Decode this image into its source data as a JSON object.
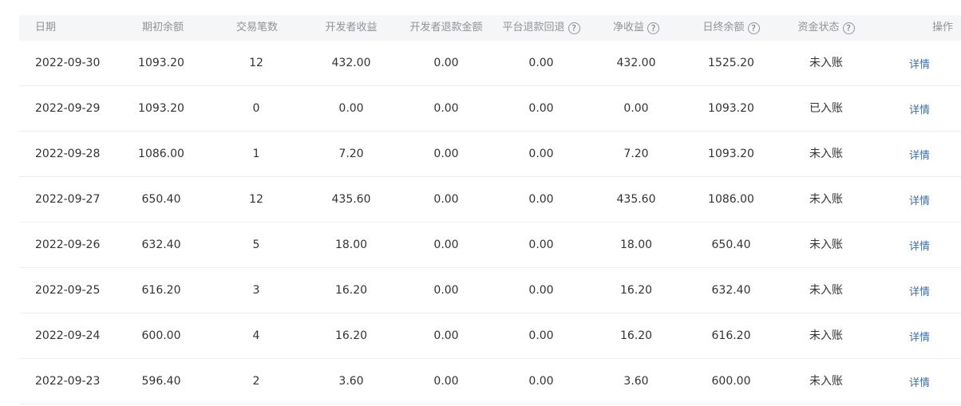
{
  "table": {
    "headers": {
      "date": "日期",
      "opening_balance": "期初余额",
      "transaction_count": "交易笔数",
      "dev_revenue": "开发者收益",
      "dev_refund": "开发者退款金额",
      "platform_refund": "平台退款回退",
      "net_revenue": "净收益",
      "closing_balance": "日终余额",
      "fund_status": "资金状态",
      "actions": "操作"
    },
    "help_glyph": "?",
    "rows": [
      {
        "date": "2022-09-30",
        "opening_balance": "1093.20",
        "transaction_count": "12",
        "dev_revenue": "432.00",
        "dev_refund": "0.00",
        "platform_refund": "0.00",
        "net_revenue": "432.00",
        "closing_balance": "1525.20",
        "fund_status": "未入账",
        "action": "详情"
      },
      {
        "date": "2022-09-29",
        "opening_balance": "1093.20",
        "transaction_count": "0",
        "dev_revenue": "0.00",
        "dev_refund": "0.00",
        "platform_refund": "0.00",
        "net_revenue": "0.00",
        "closing_balance": "1093.20",
        "fund_status": "已入账",
        "action": "详情"
      },
      {
        "date": "2022-09-28",
        "opening_balance": "1086.00",
        "transaction_count": "1",
        "dev_revenue": "7.20",
        "dev_refund": "0.00",
        "platform_refund": "0.00",
        "net_revenue": "7.20",
        "closing_balance": "1093.20",
        "fund_status": "未入账",
        "action": "详情"
      },
      {
        "date": "2022-09-27",
        "opening_balance": "650.40",
        "transaction_count": "12",
        "dev_revenue": "435.60",
        "dev_refund": "0.00",
        "platform_refund": "0.00",
        "net_revenue": "435.60",
        "closing_balance": "1086.00",
        "fund_status": "未入账",
        "action": "详情"
      },
      {
        "date": "2022-09-26",
        "opening_balance": "632.40",
        "transaction_count": "5",
        "dev_revenue": "18.00",
        "dev_refund": "0.00",
        "platform_refund": "0.00",
        "net_revenue": "18.00",
        "closing_balance": "650.40",
        "fund_status": "未入账",
        "action": "详情"
      },
      {
        "date": "2022-09-25",
        "opening_balance": "616.20",
        "transaction_count": "3",
        "dev_revenue": "16.20",
        "dev_refund": "0.00",
        "platform_refund": "0.00",
        "net_revenue": "16.20",
        "closing_balance": "632.40",
        "fund_status": "未入账",
        "action": "详情"
      },
      {
        "date": "2022-09-24",
        "opening_balance": "600.00",
        "transaction_count": "4",
        "dev_revenue": "16.20",
        "dev_refund": "0.00",
        "platform_refund": "0.00",
        "net_revenue": "16.20",
        "closing_balance": "616.20",
        "fund_status": "未入账",
        "action": "详情"
      },
      {
        "date": "2022-09-23",
        "opening_balance": "596.40",
        "transaction_count": "2",
        "dev_revenue": "3.60",
        "dev_refund": "0.00",
        "platform_refund": "0.00",
        "net_revenue": "3.60",
        "closing_balance": "600.00",
        "fund_status": "未入账",
        "action": "详情"
      }
    ]
  },
  "colors": {
    "header_bg": "#f5f6f8",
    "header_text": "#909399",
    "cell_text": "#333333",
    "link": "#3a6ea5",
    "row_border": "#ebeef5"
  }
}
